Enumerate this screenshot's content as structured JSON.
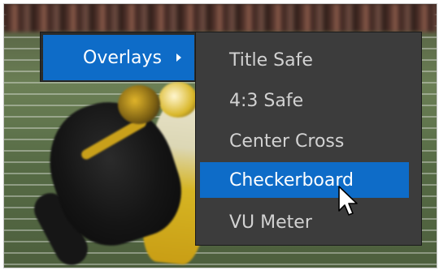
{
  "context_menu": {
    "parent_item": {
      "label": "Overlays"
    },
    "submenu_items": [
      {
        "label": "Title Safe",
        "selected": false
      },
      {
        "label": "4:3 Safe",
        "selected": false
      },
      {
        "label": "Center Cross",
        "selected": false
      },
      {
        "label": "Checkerboard",
        "selected": true
      },
      {
        "label": "VU Meter",
        "selected": false
      }
    ]
  },
  "colors": {
    "highlight": "#0e6cc8",
    "menu_bg": "#3c3c3c",
    "menu_text": "#d2d2d2",
    "highlight_text": "#ffffff"
  },
  "icons": {
    "submenu_arrow": "chevron-right-icon",
    "pointer": "mouse-pointer-icon"
  }
}
